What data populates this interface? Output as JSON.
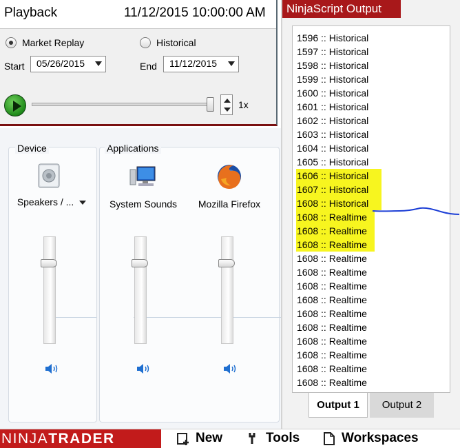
{
  "playback": {
    "title": "Playback",
    "datetime": "11/12/2015 10:00:00 AM",
    "mode_market_replay": "Market Replay",
    "mode_historical": "Historical",
    "selected_mode": "Market Replay",
    "start_label": "Start",
    "start_value": "05/26/2015",
    "end_label": "End",
    "end_value": "11/12/2015",
    "speed_label": "1x",
    "speed_position": 1.0
  },
  "mixer": {
    "device_label": "Device",
    "applications_label": "Applications",
    "device_name": "Speakers / ...",
    "apps": [
      {
        "name": "System Sounds"
      },
      {
        "name": "Mozilla Firefox"
      }
    ],
    "levels": [
      0.75,
      0.75,
      0.75
    ]
  },
  "output": {
    "title": "NinjaScript Output",
    "lines": [
      "1596 :: Historical",
      "1597 :: Historical",
      "1598 :: Historical",
      "1599 :: Historical",
      "1600 :: Historical",
      "1601 :: Historical",
      "1602 :: Historical",
      "1603 :: Historical",
      "1604 :: Historical",
      "1605 :: Historical",
      "1606 :: Historical",
      "1607 :: Historical",
      "1608 :: Historical",
      "1608 :: Realtime",
      "1608 :: Realtime",
      "1608 :: Realtime",
      "1608 :: Realtime",
      "1608 :: Realtime",
      "1608 :: Realtime",
      "1608 :: Realtime",
      "1608 :: Realtime",
      "1608 :: Realtime",
      "1608 :: Realtime",
      "1608 :: Realtime",
      "1608 :: Realtime",
      "1608 :: Realtime"
    ],
    "highlighted_lines": [
      10,
      11,
      12,
      13,
      14,
      15
    ],
    "highlight_color": "#f7f51f",
    "tabs": [
      "Output 1",
      "Output 2"
    ],
    "active_tab": "Output 1"
  },
  "bottombar": {
    "brand_part1": "NINJA",
    "brand_part2": "TRADER",
    "brand_color": "#c21b1b",
    "new_label": "New",
    "tools_label": "Tools",
    "workspaces_label": "Workspaces"
  },
  "colors": {
    "output_title_bg": "#a8181a",
    "annotation_line": "#1d3fd6"
  }
}
